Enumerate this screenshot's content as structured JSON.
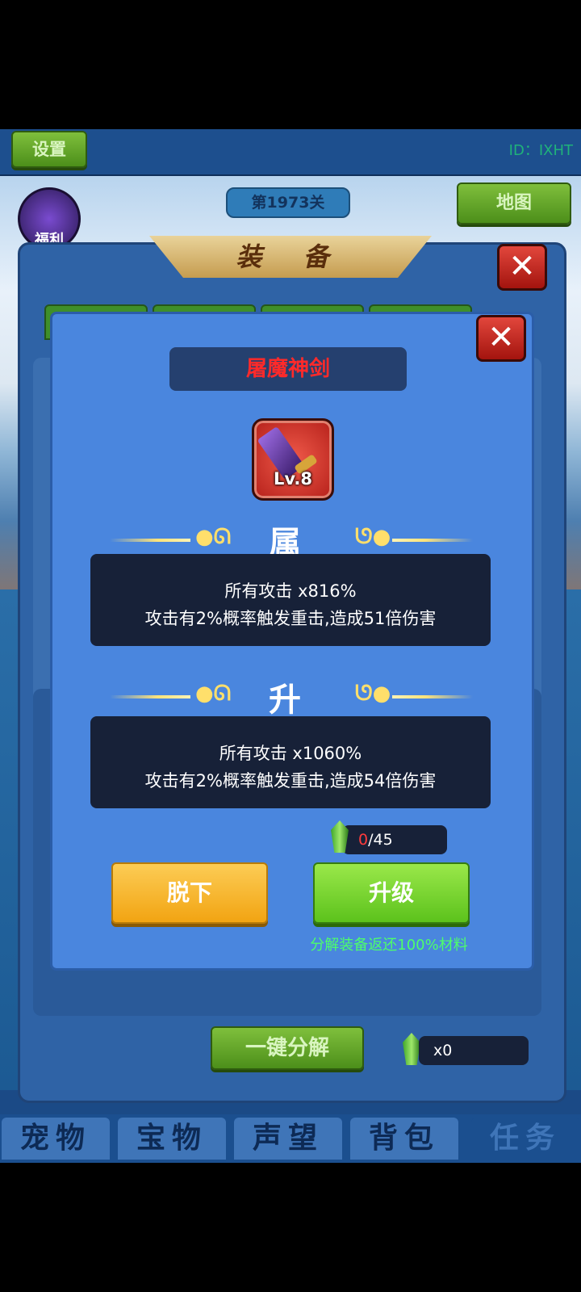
{
  "header": {
    "settings_label": "设置",
    "player_id": "ID：IXHT"
  },
  "map": {
    "stage_label": "第1973关",
    "map_button_label": "地图",
    "welfare_label": "福利"
  },
  "equipment_panel": {
    "title": "装  备",
    "decompose_all_label": "一键分解",
    "gem_count": "x0"
  },
  "item_dialog": {
    "item_name": "屠魔神剑",
    "item_level": "Lv.8",
    "attributes_title": "属 性",
    "attributes_line1": "所有攻击 x816%",
    "attributes_line2": "攻击有2%概率触发重击,造成51倍伤害",
    "upgrade_title": "升 级",
    "upgrade_line1": "所有攻击 x1060%",
    "upgrade_line2": "攻击有2%概率触发重击,造成54倍伤害",
    "material_have": "0",
    "material_need": "/45",
    "unequip_label": "脱下",
    "upgrade_label": "升级",
    "note": "分解装备返还100%材料"
  },
  "bottom_nav": {
    "tabs": [
      "宠物",
      "宝物",
      "声望",
      "背包",
      "任务"
    ]
  },
  "colors": {
    "item_name": "#ff2a2a",
    "material_have": "#ff3b3b",
    "note": "#4dff6a",
    "dialog_bg": "#4a86de"
  }
}
